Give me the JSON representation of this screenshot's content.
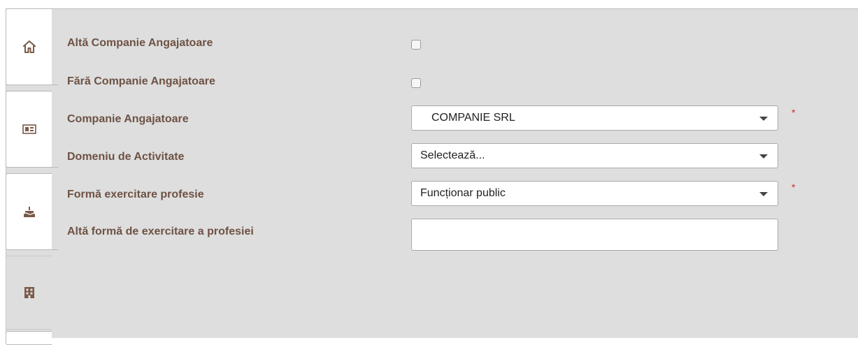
{
  "sidebar": {
    "tabs": [
      {
        "icon": "home-icon",
        "active": false
      },
      {
        "icon": "id-card-icon",
        "active": false
      },
      {
        "icon": "birthday-cake-icon",
        "active": false
      },
      {
        "icon": "building-icon",
        "active": true
      }
    ]
  },
  "form": {
    "alta_companie": {
      "label": "Altă Companie Angajatoare",
      "checked": false
    },
    "fara_companie": {
      "label": "Fără Companie Angajatoare",
      "checked": false
    },
    "companie": {
      "label": "Companie Angajatoare",
      "value": "COMPANIE SRL",
      "required_mark": "*"
    },
    "domeniu": {
      "label": "Domeniu de Activitate",
      "value": "Selectează..."
    },
    "forma": {
      "label": "Formă exercitare profesie",
      "value": "Funcționar public",
      "required_mark": "*"
    },
    "alta_forma": {
      "label": "Altă formă de exercitare a profesiei",
      "value": ""
    }
  },
  "colors": {
    "label": "#6e5244",
    "panel": "#dedede",
    "required": "#cc2b2b",
    "icon": "#7a5a48"
  }
}
